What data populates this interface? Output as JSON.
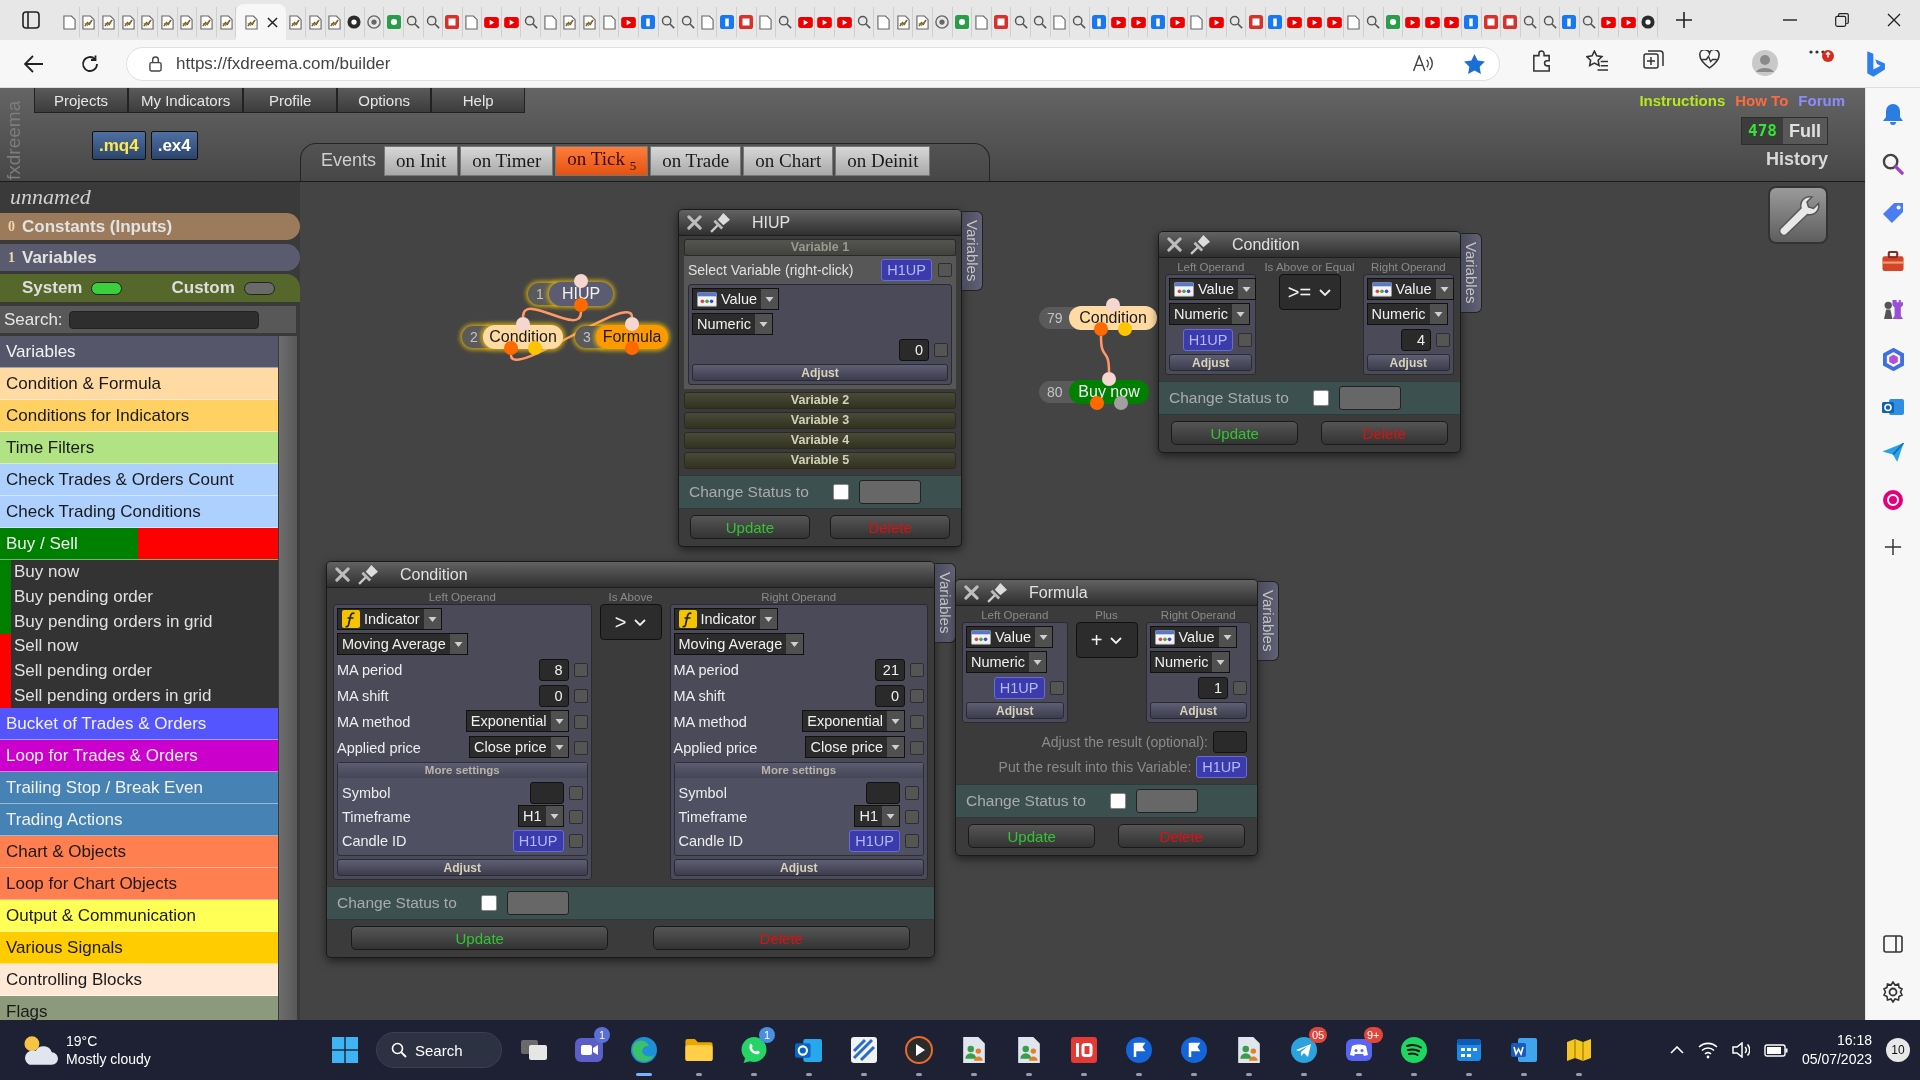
{
  "browser": {
    "tabs": [
      {
        "selected": false
      },
      {
        "selected": false
      },
      {
        "selected": false
      },
      {
        "selected": false
      },
      {
        "selected": false
      },
      {
        "selected": false
      },
      {
        "selected": false
      },
      {
        "selected": false
      },
      {
        "selected": false
      },
      {
        "selected": true
      },
      {
        "selected": false
      },
      {
        "selected": false
      },
      {
        "selected": false
      },
      {
        "selected": false
      },
      {
        "selected": false
      },
      {
        "selected": false
      },
      {
        "selected": false
      },
      {
        "selected": false
      },
      {
        "selected": false
      },
      {
        "selected": false
      },
      {
        "selected": false
      },
      {
        "selected": false
      },
      {
        "selected": false
      },
      {
        "selected": false
      },
      {
        "selected": false
      },
      {
        "selected": false
      },
      {
        "selected": false
      },
      {
        "selected": false
      },
      {
        "selected": false
      },
      {
        "selected": false
      },
      {
        "selected": false
      },
      {
        "selected": false
      },
      {
        "selected": false
      },
      {
        "selected": false
      },
      {
        "selected": false
      },
      {
        "selected": false
      },
      {
        "selected": false
      },
      {
        "selected": false
      },
      {
        "selected": false
      },
      {
        "selected": false
      },
      {
        "selected": false
      },
      {
        "selected": false
      },
      {
        "selected": false
      },
      {
        "selected": false
      },
      {
        "selected": false
      },
      {
        "selected": false
      },
      {
        "selected": false
      },
      {
        "selected": false
      },
      {
        "selected": false
      },
      {
        "selected": false
      },
      {
        "selected": false
      },
      {
        "selected": false
      },
      {
        "selected": false
      },
      {
        "selected": false
      },
      {
        "selected": false
      },
      {
        "selected": false
      },
      {
        "selected": false
      },
      {
        "selected": false
      },
      {
        "selected": false
      },
      {
        "selected": false
      },
      {
        "selected": false
      },
      {
        "selected": false
      },
      {
        "selected": false
      },
      {
        "selected": false
      },
      {
        "selected": false
      },
      {
        "selected": false
      },
      {
        "selected": false
      },
      {
        "selected": false
      },
      {
        "selected": false
      },
      {
        "selected": false
      },
      {
        "selected": false
      },
      {
        "selected": false
      },
      {
        "selected": false
      },
      {
        "selected": false
      },
      {
        "selected": false
      },
      {
        "selected": false
      },
      {
        "selected": false
      },
      {
        "selected": false
      },
      {
        "selected": false
      },
      {
        "selected": false
      }
    ],
    "address": {
      "url": "https://fxdreema.com/builder"
    }
  },
  "app": {
    "brand": "fxdreema",
    "menu": [
      "Projects",
      "My Indicators",
      "Profile",
      "Options",
      "Help"
    ],
    "links": [
      {
        "label": "Instructions",
        "color": "#b8e81c"
      },
      {
        "label": "How To",
        "color": "#ff6a3d"
      },
      {
        "label": "Forum",
        "color": "#8c8cff"
      }
    ],
    "files": [
      {
        "label": ".mq4",
        "kind": "source"
      },
      {
        "label": ".ex4",
        "kind": "compiled"
      }
    ],
    "counter": {
      "value": "478",
      "label": "Full"
    },
    "history": "History",
    "project_name": "unnamed",
    "sidebar": {
      "constants": {
        "count": "0",
        "label": "Constants (Inputs)"
      },
      "variables": {
        "count": "1",
        "label": "Variables"
      },
      "toggles": [
        {
          "label": "System",
          "on": true
        },
        {
          "label": "Custom",
          "on": false
        }
      ],
      "search": {
        "label": "Search:"
      },
      "categories": [
        {
          "label": "Variables",
          "color": "#56566a"
        },
        {
          "label": "Condition & Formula",
          "color": "#ffdaa3"
        },
        {
          "label": "Conditions for Indicators",
          "color": "#ffd163"
        },
        {
          "label": "Time Filters",
          "color": "#b1e283"
        },
        {
          "label": "Check Trades & Orders Count",
          "color": "#add0ff"
        },
        {
          "label": "Check Trading Conditions",
          "color": "#add0ff"
        },
        {
          "label": "Buy / Sell",
          "color": "#008000",
          "split": {
            "color": "#ff0000"
          },
          "children": [
            {
              "label": "Buy now",
              "color": "#008000"
            },
            {
              "label": "Buy pending order",
              "color": "#008000"
            },
            {
              "label": "Buy pending orders in grid",
              "color": "#008000"
            },
            {
              "label": "Sell now",
              "color": "#ff0000"
            },
            {
              "label": "Sell pending order",
              "color": "#ff0000"
            },
            {
              "label": "Sell pending orders in grid",
              "color": "#ff0000"
            }
          ]
        },
        {
          "label": "Bucket of Trades & Orders",
          "color": "#5555ff"
        },
        {
          "label": "Loop for Trades & Orders",
          "color": "#cc00cc"
        },
        {
          "label": "Trailing Stop / Break Even",
          "color": "#4682b4"
        },
        {
          "label": "Trading Actions",
          "color": "#4682b4"
        },
        {
          "label": "Chart & Objects",
          "color": "#ff7f50"
        },
        {
          "label": "Loop for Chart Objects",
          "color": "#ff7f50"
        },
        {
          "label": "Output & Communication",
          "color": "#ffff55"
        },
        {
          "label": "Various Signals",
          "color": "#ffcc00"
        },
        {
          "label": "Controlling Blocks",
          "color": "#ffe8d6"
        },
        {
          "label": "Flags",
          "color": "#8a9a7a"
        }
      ]
    },
    "events": {
      "label": "Events",
      "tabs": [
        {
          "label": "on Init",
          "selected": false
        },
        {
          "label": "on Timer",
          "selected": false
        },
        {
          "label": "on Tick",
          "count": "5",
          "selected": true
        },
        {
          "label": "on Trade",
          "selected": false
        },
        {
          "label": "on Chart",
          "selected": false
        },
        {
          "label": "on Deinit",
          "selected": false
        }
      ]
    },
    "blocks": [
      {
        "number": "1",
        "label": "HIUP",
        "kind": "variables",
        "color": "#5b5b72",
        "selected": true,
        "linked_to_next": true
      },
      {
        "number": "2",
        "label": "Condition",
        "kind": "condition",
        "color": "#ffdaa3",
        "selected": true,
        "linked_to_next": true
      },
      {
        "number": "3",
        "label": "Formula",
        "kind": "formula",
        "color": "#ff9900",
        "selected": true,
        "linked_to_next": false
      },
      {
        "number": "79",
        "label": "Condition",
        "kind": "condition",
        "color": "#ffdaa3",
        "selected": false,
        "linked_to_next": true
      },
      {
        "number": "80",
        "label": "Buy now",
        "kind": "action",
        "color": "#008000",
        "selected": false
      }
    ],
    "windows": [
      {
        "kind": "variables",
        "title": "HIUP",
        "side_tab": "Variables",
        "sections": [
          {
            "label": "Variable 1",
            "expanded": true,
            "select_label": "Select Variable (right-click)",
            "variable": {
              "value": "H1UP",
              "checked": false
            },
            "operand": {
              "source": {
                "kind": "value",
                "label": "Value"
              },
              "type": "Numeric",
              "params": [
                {
                  "kind": "number",
                  "value": "0",
                  "checked": false
                }
              ],
              "adjust": "Adjust"
            }
          },
          {
            "label": "Variable 2",
            "expanded": false
          },
          {
            "label": "Variable 3",
            "expanded": false
          },
          {
            "label": "Variable 4",
            "expanded": false
          },
          {
            "label": "Variable 5",
            "expanded": false
          }
        ],
        "status": {
          "label": "Change Status to",
          "checked": false
        },
        "update": "Update",
        "delete": "Delete"
      },
      {
        "kind": "condition",
        "title": "Condition",
        "side_tab": "Variables",
        "left": {
          "heading": "Left Operand",
          "source": {
            "kind": "value",
            "label": "Value"
          },
          "type": "Numeric",
          "params": [
            {
              "kind": "variable",
              "value": "H1UP",
              "checked": false
            }
          ],
          "adjust": "Adjust"
        },
        "operator": {
          "heading": "Is Above or Equal",
          "symbol": ">="
        },
        "right": {
          "heading": "Right Operand",
          "source": {
            "kind": "value",
            "label": "Value"
          },
          "type": "Numeric",
          "params": [
            {
              "kind": "number",
              "value": "4",
              "checked": false
            }
          ],
          "adjust": "Adjust"
        },
        "status": {
          "label": "Change Status to",
          "checked": false
        },
        "update": "Update",
        "delete": "Delete"
      },
      {
        "kind": "condition",
        "title": "Condition",
        "side_tab": "Variables",
        "left": {
          "heading": "Left Operand",
          "source": {
            "kind": "indicator",
            "label": "Indicator"
          },
          "type": "Moving Average",
          "params": [
            {
              "label": "MA period",
              "kind": "number",
              "value": "8",
              "checked": false
            },
            {
              "label": "MA shift",
              "kind": "number",
              "value": "0",
              "checked": false
            },
            {
              "label": "MA method",
              "kind": "select",
              "value": "Exponential",
              "checked": false
            },
            {
              "label": "Applied price",
              "kind": "select",
              "value": "Close price",
              "checked": false
            }
          ],
          "more": {
            "label": "More settings",
            "params": [
              {
                "label": "Symbol",
                "kind": "text",
                "checked": false
              },
              {
                "label": "Timeframe",
                "kind": "select",
                "value": "H1",
                "checked": false
              },
              {
                "label": "Candle ID",
                "kind": "variable",
                "value": "H1UP",
                "checked": false
              }
            ]
          },
          "adjust": "Adjust"
        },
        "operator": {
          "heading": "Is Above",
          "symbol": ">"
        },
        "right": {
          "heading": "Right Operand",
          "source": {
            "kind": "indicator",
            "label": "Indicator"
          },
          "type": "Moving Average",
          "params": [
            {
              "label": "MA period",
              "kind": "number",
              "value": "21",
              "checked": false
            },
            {
              "label": "MA shift",
              "kind": "number",
              "value": "0",
              "checked": false
            },
            {
              "label": "MA method",
              "kind": "select",
              "value": "Exponential",
              "checked": false
            },
            {
              "label": "Applied price",
              "kind": "select",
              "value": "Close price",
              "checked": false
            }
          ],
          "more": {
            "label": "More settings",
            "params": [
              {
                "label": "Symbol",
                "kind": "text",
                "checked": false
              },
              {
                "label": "Timeframe",
                "kind": "select",
                "value": "H1",
                "checked": false
              },
              {
                "label": "Candle ID",
                "kind": "variable",
                "value": "H1UP",
                "checked": false
              }
            ]
          },
          "adjust": "Adjust"
        },
        "status": {
          "label": "Change Status to",
          "checked": false
        },
        "update": "Update",
        "delete": "Delete"
      },
      {
        "kind": "formula",
        "title": "Formula",
        "side_tab": "Variables",
        "left": {
          "heading": "Left Operand",
          "source": {
            "kind": "value",
            "label": "Value"
          },
          "type": "Numeric",
          "params": [
            {
              "kind": "variable",
              "value": "H1UP",
              "checked": false
            }
          ],
          "adjust": "Adjust"
        },
        "operator": {
          "heading": "Plus",
          "symbol": "+"
        },
        "right": {
          "heading": "Right Operand",
          "source": {
            "kind": "value",
            "label": "Value"
          },
          "type": "Numeric",
          "params": [
            {
              "kind": "number",
              "value": "1",
              "checked": false
            }
          ],
          "adjust": "Adjust"
        },
        "result_adjust": {
          "label": "Adjust the result (optional):"
        },
        "result_variable": {
          "label": "Put the result into this Variable:",
          "value": "H1UP"
        },
        "status": {
          "label": "Change Status to",
          "checked": false
        },
        "update": "Update",
        "delete": "Delete"
      }
    ]
  },
  "taskbar": {
    "weather": {
      "temperature": "19°C",
      "condition": "Mostly cloudy"
    },
    "search": {
      "label": "Search"
    },
    "apps": [
      {
        "kind": "task-view",
        "running": false,
        "selected": false
      },
      {
        "kind": "video-chat",
        "badge": {
          "label": "1",
          "color": "#5b6fd8"
        },
        "running": false,
        "selected": false
      },
      {
        "kind": "browser",
        "running": true,
        "selected": true
      },
      {
        "kind": "folder",
        "running": true,
        "selected": false
      },
      {
        "kind": "messenger",
        "badge": {
          "label": "1",
          "color": "#4a8fe0"
        },
        "running": true,
        "selected": false
      },
      {
        "kind": "mail",
        "running": true,
        "selected": false
      },
      {
        "kind": "chart",
        "running": true,
        "selected": false
      },
      {
        "kind": "player",
        "running": true,
        "selected": false
      },
      {
        "kind": "remote",
        "running": true,
        "selected": false
      },
      {
        "kind": "remote",
        "running": true,
        "selected": false
      },
      {
        "kind": "red-tile",
        "running": true,
        "selected": false
      },
      {
        "kind": "flag-circle",
        "running": true,
        "selected": false
      },
      {
        "kind": "flag-circle",
        "running": true,
        "selected": false
      },
      {
        "kind": "remote",
        "running": true,
        "selected": false
      },
      {
        "kind": "plane",
        "badge": {
          "label": "05",
          "color": "#e0463a"
        },
        "running": true,
        "selected": false
      },
      {
        "kind": "gamepad",
        "badge": {
          "label": "9+",
          "color": "#e0463a"
        },
        "running": true,
        "selected": false
      },
      {
        "kind": "music",
        "running": true,
        "selected": false
      },
      {
        "kind": "calendar",
        "running": true,
        "selected": false
      },
      {
        "kind": "document",
        "running": true,
        "selected": false
      },
      {
        "kind": "map",
        "running": true,
        "selected": false
      }
    ],
    "clock": {
      "time": "16:18",
      "date": "05/07/2023"
    },
    "notifications": {
      "count": "10"
    }
  }
}
